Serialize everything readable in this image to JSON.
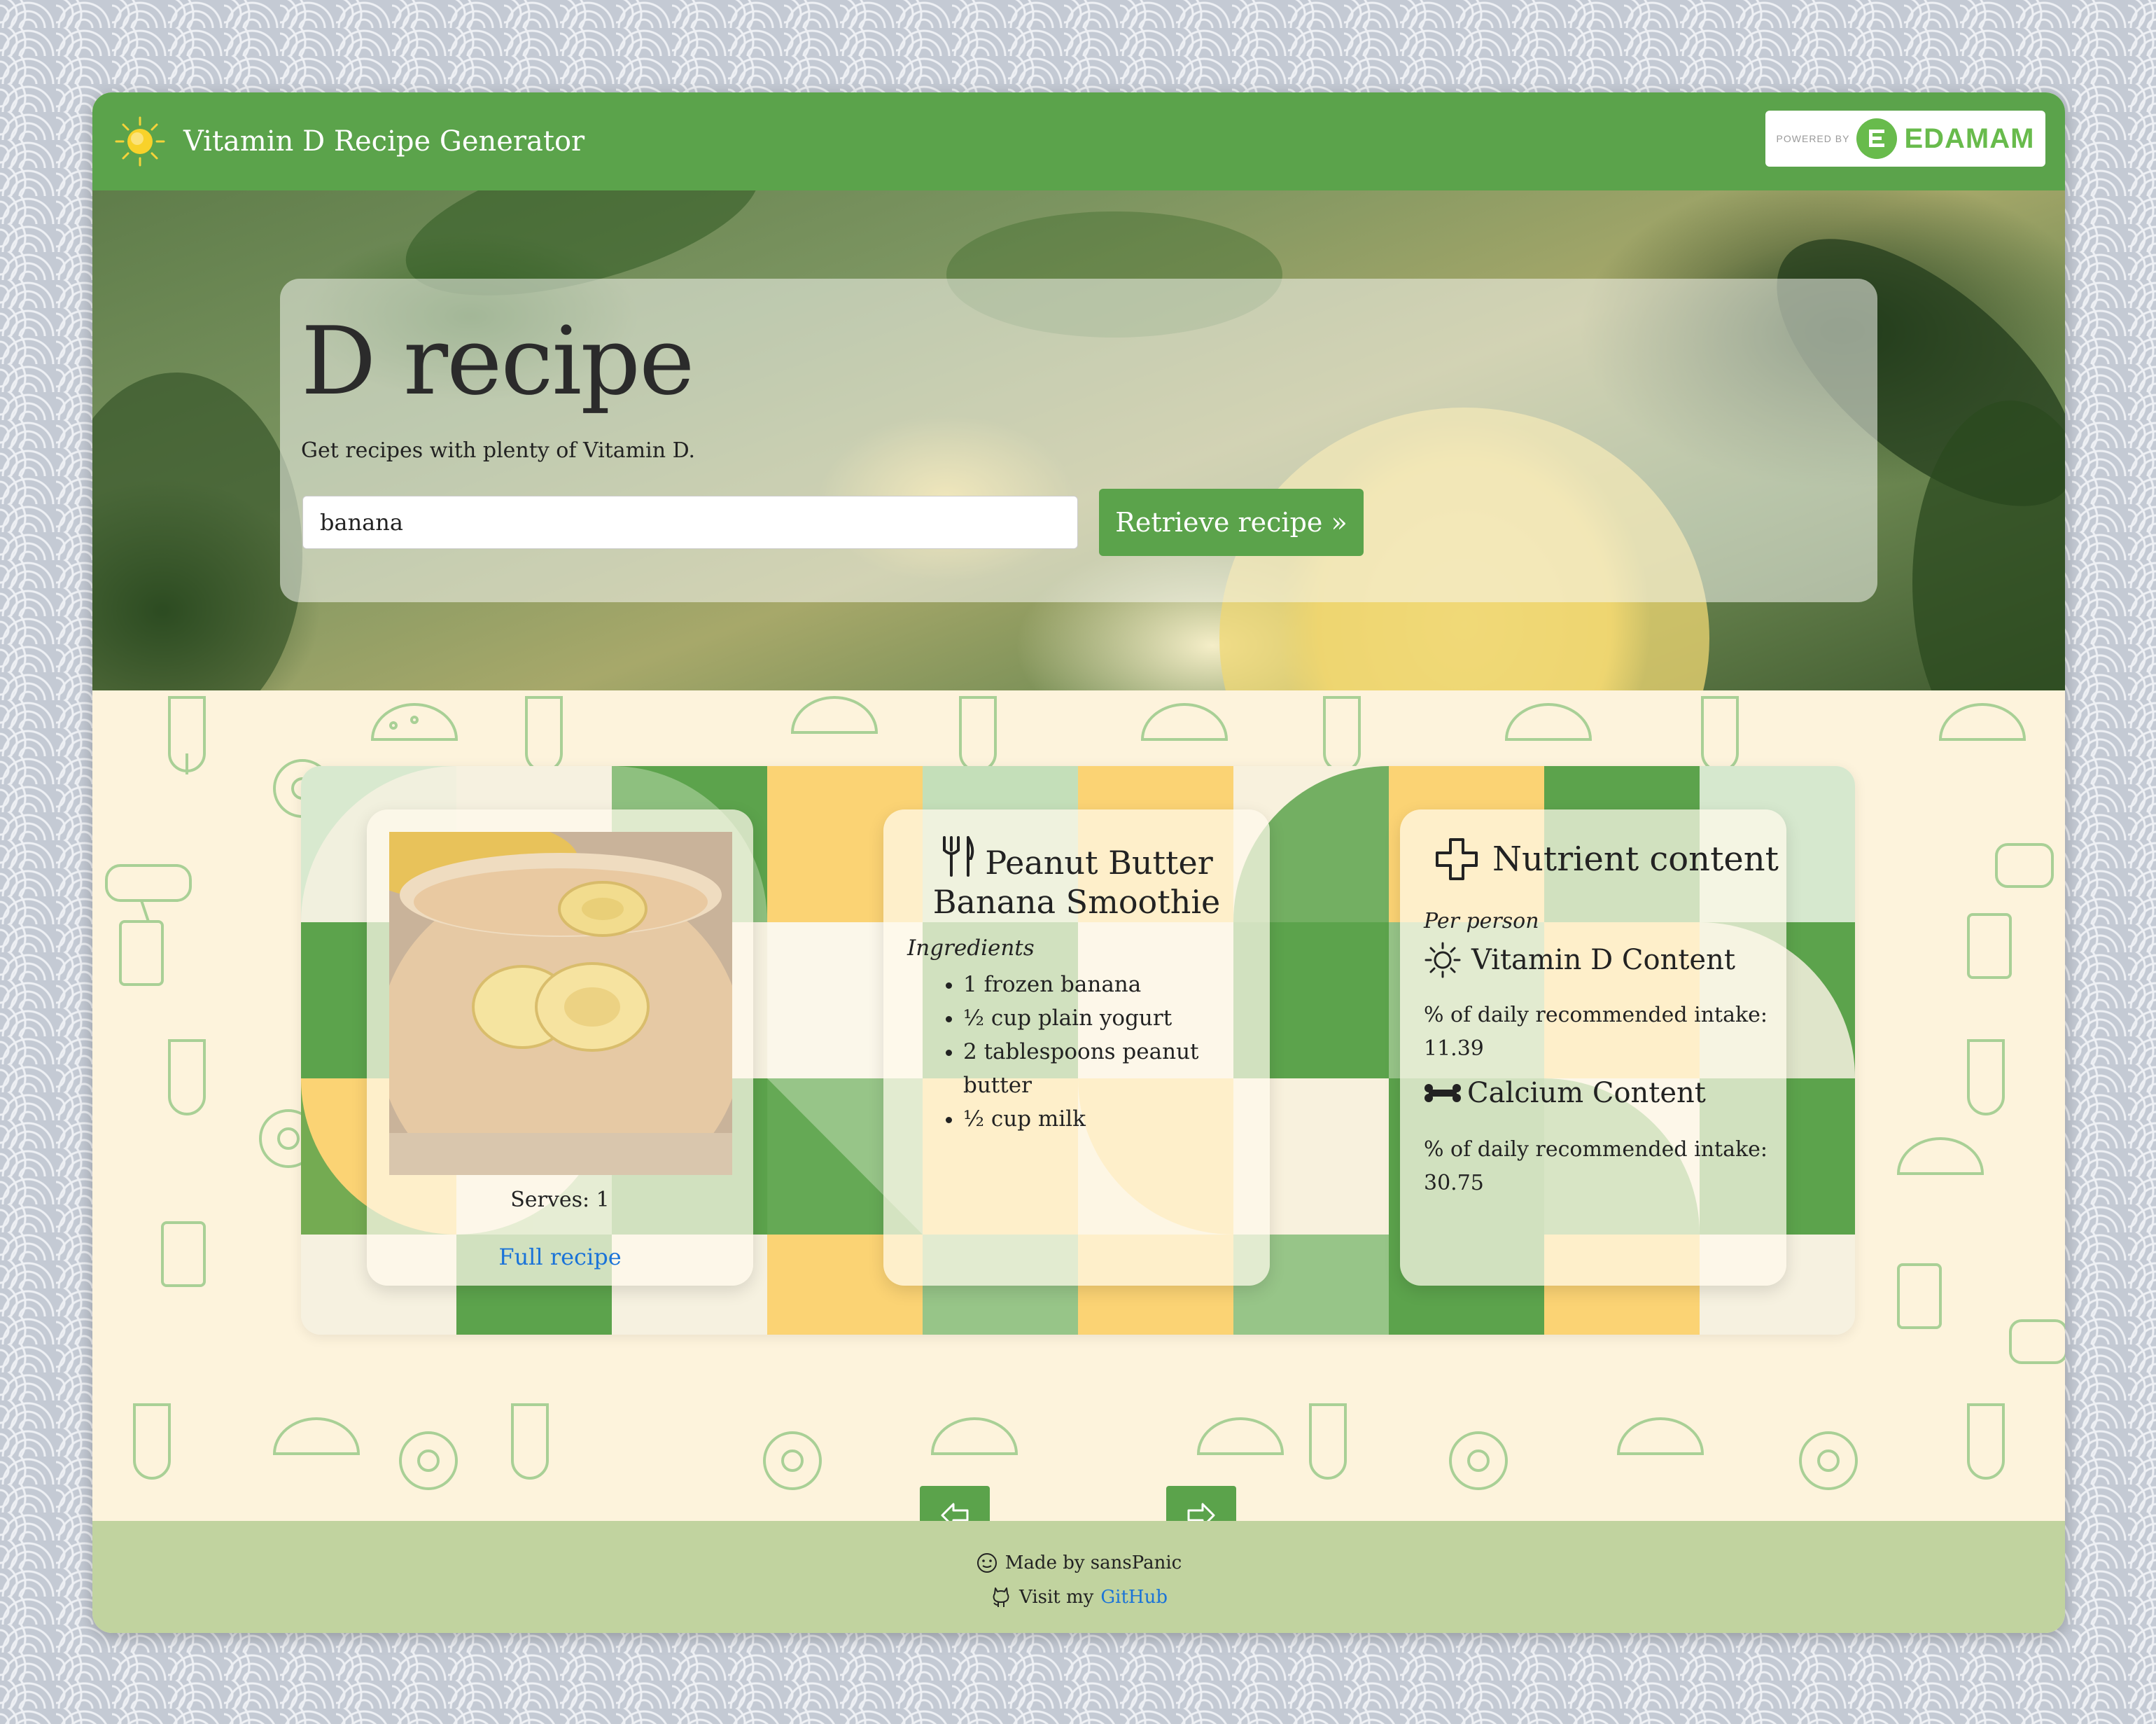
{
  "navbar": {
    "brand_title": "Vitamin D Recipe Generator",
    "brand_icon": "sun-icon",
    "edamam": {
      "powered_by": "POWERED BY",
      "name": "EDAMAM"
    }
  },
  "hero": {
    "title": "D recipe",
    "subtitle": "Get recipes with plenty of Vitamin D.",
    "search": {
      "value": "banana"
    },
    "retrieve_label": "Retrieve recipe »"
  },
  "recipe": {
    "serves": "Serves: 1",
    "full_recipe_label": "Full recipe",
    "title": "Peanut Butter Banana Smoothie",
    "ingredients_label": "Ingredients",
    "ingredients": [
      "1 frozen banana",
      "½ cup plain yogurt",
      "2 tablespoons peanut butter",
      "½ cup milk"
    ]
  },
  "nutrients": {
    "title": "Nutrient content",
    "per_person": "Per person",
    "vitamin_d": {
      "heading": "Vitamin D Content",
      "label": "% of daily recommended intake:",
      "value": "11.39"
    },
    "calcium": {
      "heading": "Calcium Content",
      "label": "% of daily recommended intake:",
      "value": "30.75"
    }
  },
  "carousel": {
    "prev_icon": "arrow-left-icon",
    "next_icon": "arrow-right-icon"
  },
  "footer": {
    "made_by": "Made by sansPanic",
    "visit_prefix": "Visit my",
    "github_label": "GitHub"
  },
  "colors": {
    "brand_green": "#5ba34b",
    "footer_bg": "#c1d39f",
    "link_blue": "#1a73d8",
    "page_cream": "#fdf3dc"
  }
}
